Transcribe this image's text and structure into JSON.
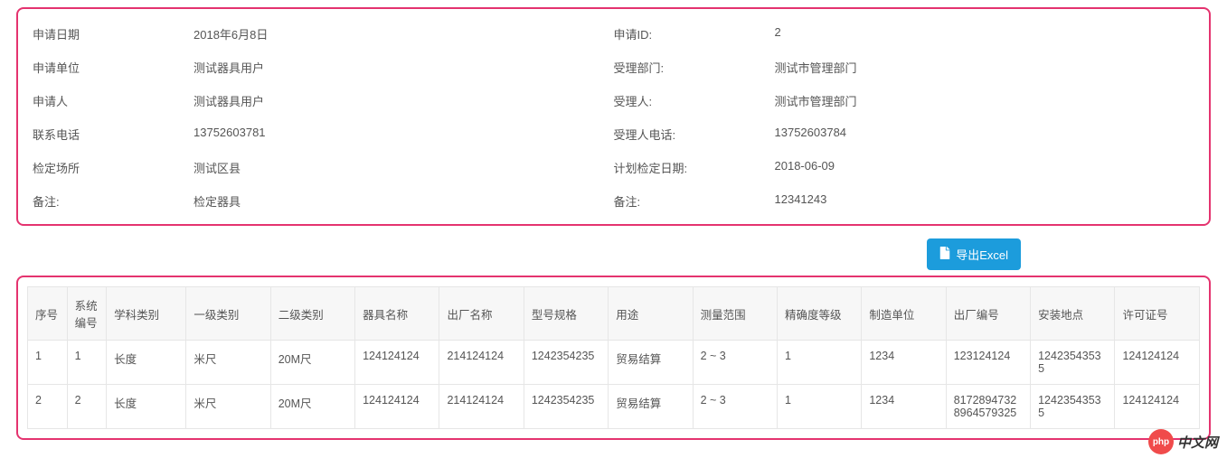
{
  "info": {
    "rows": [
      {
        "leftLabel": "申请日期",
        "leftValue": "2018年6月8日",
        "rightLabel": "申请ID:",
        "rightValue": "2"
      },
      {
        "leftLabel": "申请单位",
        "leftValue": "测试器具用户",
        "rightLabel": "受理部门:",
        "rightValue": "测试市管理部门"
      },
      {
        "leftLabel": "申请人",
        "leftValue": "测试器具用户",
        "rightLabel": "受理人:",
        "rightValue": "测试市管理部门"
      },
      {
        "leftLabel": "联系电话",
        "leftValue": "13752603781",
        "rightLabel": "受理人电话:",
        "rightValue": "13752603784"
      },
      {
        "leftLabel": "检定场所",
        "leftValue": "测试区县",
        "rightLabel": "计划检定日期:",
        "rightValue": "2018-06-09"
      },
      {
        "leftLabel": "备注:",
        "leftValue": "检定器具",
        "rightLabel": "备注:",
        "rightValue": "12341243"
      }
    ]
  },
  "exportButton": {
    "label": "导出Excel"
  },
  "table": {
    "headers": {
      "seq": "序号",
      "sysno": "系统编号",
      "subject": "学科类别",
      "cat1": "一级类别",
      "cat2": "二级类别",
      "name": "器具名称",
      "factory": "出厂名称",
      "model": "型号规格",
      "use": "用途",
      "range": "测量范围",
      "precision": "精确度等级",
      "maker": "制造单位",
      "factoryno": "出厂编号",
      "install": "安装地点",
      "license": "许可证号"
    },
    "rows": [
      {
        "seq": "1",
        "sysno": "1",
        "subject": "长度",
        "cat1": "米尺",
        "cat2": "20M尺",
        "name": "124124124",
        "factory": "214124124",
        "model": "1242354235",
        "use": "贸易结算",
        "range": "2 ~ 3",
        "precision": "1",
        "maker": "1234",
        "factoryno": "123124124",
        "install": "12423543535",
        "license": "124124124"
      },
      {
        "seq": "2",
        "sysno": "2",
        "subject": "长度",
        "cat1": "米尺",
        "cat2": "20M尺",
        "name": "124124124",
        "factory": "214124124",
        "model": "1242354235",
        "use": "贸易结算",
        "range": "2 ~ 3",
        "precision": "1",
        "maker": "1234",
        "factoryno": "81728947328964579325",
        "install": "12423543535",
        "license": "124124124"
      }
    ]
  },
  "watermark": {
    "badge": "php",
    "text": "中文网"
  }
}
